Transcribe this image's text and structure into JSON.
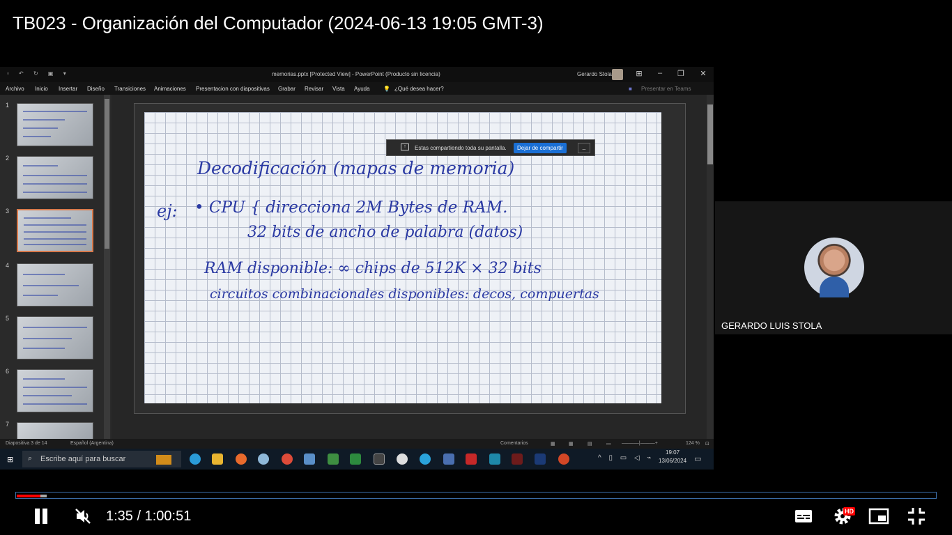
{
  "video": {
    "title": "TB023 - Organización del Computador (2024-06-13 19:05 GMT-3)"
  },
  "powerpoint": {
    "window_title": "memorias.pptx [Protected View] - PowerPoint (Producto sin licencia)",
    "user_name": "Gerardo Stola",
    "ribbon": [
      "Archivo",
      "Inicio",
      "Insertar",
      "Diseño",
      "Transiciones",
      "Animaciones",
      "Presentacion con diapositivas",
      "Grabar",
      "Revisar",
      "Vista",
      "Ayuda"
    ],
    "tell_me": "¿Qué desea hacer?",
    "present_teams": "Presentar en Teams",
    "thumbnails": [
      "1",
      "2",
      "3",
      "4",
      "5",
      "6",
      "7"
    ],
    "selected_thumbnail": 3,
    "share_banner": {
      "text": "Estas compartiendo toda su pantalla.",
      "stop_label": "Dejar de compartir",
      "minimize_label": "_"
    },
    "slide_handwriting": {
      "line1": "Decodificación (mapas de memoria)",
      "prefix": "ej:",
      "line2": "• CPU { direcciona 2M Bytes de RAM.",
      "line3": "32 bits de ancho de palabra (datos)",
      "line4": "RAM disponible: ∞ chips de 512K × 32 bits",
      "line5": "circuitos combinacionales disponibles: decos, compuertas"
    },
    "status": {
      "slide_counter": "Diapositiva 3 de 14",
      "language": "Español (Argentina)",
      "comments": "Comentarios",
      "zoom": "124 %"
    }
  },
  "taskbar": {
    "search_placeholder": "Escribe aquí para buscar",
    "time": "19:07",
    "date": "13/06/2024"
  },
  "participant": {
    "name": "GERARDO LUIS STOLA"
  },
  "player": {
    "current_time": "1:35",
    "duration": "1:00:51",
    "time_display": "1:35 / 1:00:51",
    "played_fraction": 0.026,
    "buffered_fraction": 0.033,
    "hd_badge": "HD"
  }
}
